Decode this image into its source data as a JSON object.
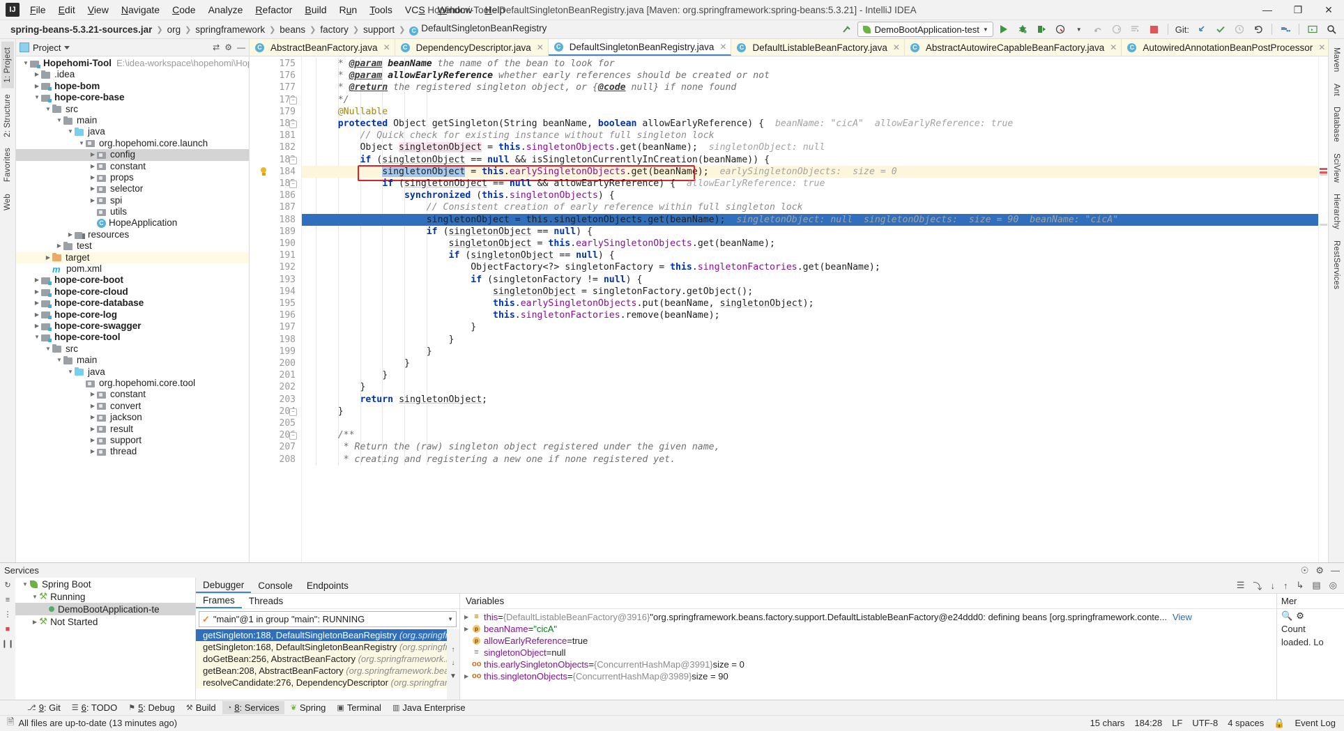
{
  "titlebar": {
    "logo": "IJ",
    "menus": [
      "File",
      "Edit",
      "View",
      "Navigate",
      "Code",
      "Analyze",
      "Refactor",
      "Build",
      "Run",
      "Tools",
      "VCS",
      "Window",
      "Help"
    ],
    "window_title": "Hopehomi-Tool - DefaultSingletonBeanRegistry.java [Maven: org.springframework:spring-beans:5.3.21] - IntelliJ IDEA",
    "minimize": "—",
    "maximize": "❐",
    "close": "✕"
  },
  "navbar": {
    "crumbs": [
      "spring-beans-5.3.21-sources.jar",
      "org",
      "springframework",
      "beans",
      "factory",
      "support",
      "DefaultSingletonBeanRegistry"
    ],
    "class_icon_letter": "C",
    "run_config": "DemoBootApplication-test",
    "git_label": "Git:"
  },
  "left_strip": {
    "tabs": [
      "1: Project",
      "2: Structure",
      "Favorites",
      "Web"
    ]
  },
  "right_strip": {
    "tabs": [
      "Maven",
      "Ant",
      "Database",
      "SciView",
      "Hierarchy",
      "RestServices"
    ]
  },
  "project": {
    "title": "Project",
    "tree": [
      {
        "depth": 0,
        "arrow": "down",
        "icon": "f-mod",
        "label": "Hopehomi-Tool",
        "bold": true,
        "path": "E:\\idea-workspace\\hopehomi\\Hopehomi-Too"
      },
      {
        "depth": 1,
        "arrow": "right",
        "icon": "f-gray",
        "label": ".idea",
        "bold": false
      },
      {
        "depth": 1,
        "arrow": "right",
        "icon": "f-mod",
        "label": "hope-bom",
        "bold": true
      },
      {
        "depth": 1,
        "arrow": "down",
        "icon": "f-mod",
        "label": "hope-core-base",
        "bold": true
      },
      {
        "depth": 2,
        "arrow": "down",
        "icon": "f-gray",
        "label": "src",
        "bold": false
      },
      {
        "depth": 3,
        "arrow": "down",
        "icon": "f-gray",
        "label": "main",
        "bold": false
      },
      {
        "depth": 4,
        "arrow": "down",
        "icon": "f-blue",
        "label": "java",
        "bold": false
      },
      {
        "depth": 5,
        "arrow": "down",
        "icon": "f-pkg",
        "label": "org.hopehomi.core.launch",
        "bold": false
      },
      {
        "depth": 6,
        "arrow": "right",
        "icon": "f-pkg",
        "label": "config",
        "bold": false,
        "state": "sel"
      },
      {
        "depth": 6,
        "arrow": "right",
        "icon": "f-pkg",
        "label": "constant",
        "bold": false
      },
      {
        "depth": 6,
        "arrow": "right",
        "icon": "f-pkg",
        "label": "props",
        "bold": false
      },
      {
        "depth": 6,
        "arrow": "right",
        "icon": "f-pkg",
        "label": "selector",
        "bold": false
      },
      {
        "depth": 6,
        "arrow": "right",
        "icon": "f-pkg",
        "label": "spi",
        "bold": false
      },
      {
        "depth": 6,
        "arrow": "none",
        "icon": "f-pkg",
        "label": "utils",
        "bold": false
      },
      {
        "depth": 6,
        "arrow": "none",
        "icon": "i-class",
        "label": "HopeApplication",
        "bold": false
      },
      {
        "depth": 4,
        "arrow": "right",
        "icon": "f-res",
        "label": "resources",
        "bold": false
      },
      {
        "depth": 3,
        "arrow": "right",
        "icon": "f-gray",
        "label": "test",
        "bold": false
      },
      {
        "depth": 2,
        "arrow": "right",
        "icon": "f-orange",
        "label": "target",
        "bold": false,
        "state": "hl"
      },
      {
        "depth": 2,
        "arrow": "none",
        "icon": "i-mvn",
        "label": "pom.xml",
        "bold": false
      },
      {
        "depth": 1,
        "arrow": "right",
        "icon": "f-mod",
        "label": "hope-core-boot",
        "bold": true
      },
      {
        "depth": 1,
        "arrow": "right",
        "icon": "f-mod",
        "label": "hope-core-cloud",
        "bold": true
      },
      {
        "depth": 1,
        "arrow": "right",
        "icon": "f-mod",
        "label": "hope-core-database",
        "bold": true
      },
      {
        "depth": 1,
        "arrow": "right",
        "icon": "f-mod",
        "label": "hope-core-log",
        "bold": true
      },
      {
        "depth": 1,
        "arrow": "right",
        "icon": "f-mod",
        "label": "hope-core-swagger",
        "bold": true
      },
      {
        "depth": 1,
        "arrow": "down",
        "icon": "f-mod",
        "label": "hope-core-tool",
        "bold": true
      },
      {
        "depth": 2,
        "arrow": "down",
        "icon": "f-gray",
        "label": "src",
        "bold": false
      },
      {
        "depth": 3,
        "arrow": "down",
        "icon": "f-gray",
        "label": "main",
        "bold": false
      },
      {
        "depth": 4,
        "arrow": "down",
        "icon": "f-blue",
        "label": "java",
        "bold": false
      },
      {
        "depth": 5,
        "arrow": "none",
        "icon": "f-pkg",
        "label": "org.hopehomi.core.tool",
        "bold": false
      },
      {
        "depth": 6,
        "arrow": "right",
        "icon": "f-pkg",
        "label": "constant",
        "bold": false
      },
      {
        "depth": 6,
        "arrow": "right",
        "icon": "f-pkg",
        "label": "convert",
        "bold": false
      },
      {
        "depth": 6,
        "arrow": "right",
        "icon": "f-pkg",
        "label": "jackson",
        "bold": false
      },
      {
        "depth": 6,
        "arrow": "right",
        "icon": "f-pkg",
        "label": "result",
        "bold": false
      },
      {
        "depth": 6,
        "arrow": "right",
        "icon": "f-pkg",
        "label": "support",
        "bold": false
      },
      {
        "depth": 6,
        "arrow": "right",
        "icon": "f-pkg",
        "label": "thread",
        "bold": false
      }
    ]
  },
  "editor": {
    "tabs": [
      {
        "label": "AbstractBeanFactory.java",
        "active": false
      },
      {
        "label": "DependencyDescriptor.java",
        "active": false
      },
      {
        "label": "DefaultSingletonBeanRegistry.java",
        "active": true
      },
      {
        "label": "DefaultListableBeanFactory.java",
        "active": false
      },
      {
        "label": "AbstractAutowireCapableBeanFactory.java",
        "active": false
      },
      {
        "label": "AutowiredAnnotationBeanPostProcessor",
        "active": false
      }
    ],
    "first_line": 175,
    "lines": [
      {
        "n": 175,
        "html": "     <span class='jd'>* </span><span class='jdt'>@param</span><span class='jdb'> beanName </span><span class='jd'>the name of the bean to look for</span>"
      },
      {
        "n": 176,
        "html": "     <span class='jd'>* </span><span class='jdt'>@param</span><span class='jdb'> allowEarlyReference </span><span class='jd'>whether early references should be created or not</span>"
      },
      {
        "n": 177,
        "html": "     <span class='jd'>* </span><span class='jdt'>@return</span><span class='jd'> the registered singleton object, or {</span><span class='jdt'>@code</span><span class='jd'> null} if none found</span>"
      },
      {
        "n": 178,
        "html": "     <span class='jd'>*/</span>",
        "fold": true
      },
      {
        "n": 179,
        "html": "     <span class='ann'>@Nullable</span>"
      },
      {
        "n": 180,
        "html": "     <span class='k'>protected</span> Object getSingleton(String beanName, <span class='k'>boolean</span> allowEarlyReference) {  <span class='hint'>beanName: \"cicA\"  allowEarlyReference: true</span>",
        "fold": true
      },
      {
        "n": 181,
        "html": "         <span class='com'>// Quick check for existing instance without full singleton lock</span>"
      },
      {
        "n": 182,
        "html": "         Object <span class='pinkbg usg'>singletonObject</span> = <span class='k'>this</span>.<span class='fld'>singletonObjects</span>.get(beanName);  <span class='hint'>singletonObject: null</span>"
      },
      {
        "n": 183,
        "html": "         <span class='k'>if</span> (<span class='usg errund'>singletonObject</span> == <span class='k'>null</span> &amp;&amp; isSingletonCurrentlyInCreation(beanName)) {",
        "fold": true
      },
      {
        "n": 184,
        "html": "             <span class='bluesel'>singletonObject</span> = <span class='k'>this</span>.<span class='fld'>earlySingletonObjects</span>.get(beanName);  <span class='hint'>earlySingletonObjects:  size = 0</span>",
        "caret": true,
        "bulb": true,
        "redbox": true
      },
      {
        "n": 185,
        "html": "             <span class='k'>if</span> (<span class='usg'>singletonObject</span> == <span class='k'>null</span> &amp;&amp; allowEarlyReference) {  <span class='hint'>allowEarlyReference: true</span>",
        "fold": true
      },
      {
        "n": 186,
        "html": "                 <span class='k'>synchronized</span> (<span class='k'>this</span>.<span class='fld'>singletonObjects</span>) {"
      },
      {
        "n": 187,
        "html": "                     <span class='com'>// Consistent creation of early reference within full singleton lock</span>"
      },
      {
        "n": 188,
        "html": "                     singletonObject = this.singletonObjects.get(beanName);  <span class='hint'>singletonObject: null  singletonObjects:  size = 90  beanName: \"cicA\"</span>",
        "selected": true
      },
      {
        "n": 189,
        "html": "                     <span class='k'>if</span> (<span class='usg'>singletonObject</span> == <span class='k'>null</span>) {"
      },
      {
        "n": 190,
        "html": "                         <span class='usg'>singletonObject</span> = <span class='k'>this</span>.<span class='fld'>earlySingletonObjects</span>.get(beanName);"
      },
      {
        "n": 191,
        "html": "                         <span class='k'>if</span> (<span class='usg'>singletonObject</span> == <span class='k'>null</span>) {"
      },
      {
        "n": 192,
        "html": "                             ObjectFactory&lt;?&gt; singletonFactory = <span class='k'>this</span>.<span class='fld'>singletonFactories</span>.get(beanName);"
      },
      {
        "n": 193,
        "html": "                             <span class='k'>if</span> (singletonFactory != <span class='k'>null</span>) {"
      },
      {
        "n": 194,
        "html": "                                 <span class='usg'>singletonObject</span> = singletonFactory.getObject();"
      },
      {
        "n": 195,
        "html": "                                 <span class='k'>this</span>.<span class='fld'>earlySingletonObjects</span>.put(beanName, <span class='usg'>singletonObject</span>);"
      },
      {
        "n": 196,
        "html": "                                 <span class='k'>this</span>.<span class='fld'>singletonFactories</span>.remove(beanName);"
      },
      {
        "n": 197,
        "html": "                             }"
      },
      {
        "n": 198,
        "html": "                         }"
      },
      {
        "n": 199,
        "html": "                     }"
      },
      {
        "n": 200,
        "html": "                 }"
      },
      {
        "n": 201,
        "html": "             }"
      },
      {
        "n": 202,
        "html": "         }"
      },
      {
        "n": 203,
        "html": "         <span class='k'>return</span> <span class='usg'>singletonObject</span>;"
      },
      {
        "n": 204,
        "html": "     }",
        "fold": true
      },
      {
        "n": 205,
        "html": ""
      },
      {
        "n": 206,
        "html": "     <span class='jd'>/**</span>",
        "fold": true
      },
      {
        "n": 207,
        "html": "      <span class='jd'>* Return the (raw) singleton object registered under the given name,</span>"
      },
      {
        "n": 208,
        "html": "      <span class='jd'>* creating and registering a new one if none registered yet.</span>"
      }
    ]
  },
  "services": {
    "title": "Services",
    "tree": [
      {
        "label": "Spring Boot",
        "kind": "root",
        "arrow": "down"
      },
      {
        "label": "Running",
        "kind": "group",
        "arrow": "down"
      },
      {
        "label": "DemoBootApplication-te",
        "kind": "item",
        "arrow": "none",
        "selected": true
      },
      {
        "label": "Not Started",
        "kind": "group",
        "arrow": "right"
      }
    ],
    "debug_tabs": [
      {
        "label": "Debugger",
        "active": true,
        "icon": ""
      },
      {
        "label": "Console",
        "active": false,
        "icon": "console-icon"
      },
      {
        "label": "Endpoints",
        "active": false,
        "icon": "endpoints-icon"
      }
    ],
    "frames": {
      "tabs": [
        "Frames",
        "Threads"
      ],
      "active_tab": "Frames",
      "thread_selector": "\"main\"@1 in group \"main\": RUNNING",
      "items": [
        {
          "method": "getSingleton:188, DefaultSingletonBeanRegistry ",
          "pkg": "(org.springframework.beans",
          "selected": true
        },
        {
          "method": "getSingleton:168, DefaultSingletonBeanRegistry ",
          "pkg": "(org.springframework.beans",
          "selected": false
        },
        {
          "method": "doGetBean:256, AbstractBeanFactory ",
          "pkg": "(org.springframework.beans.factory.su",
          "selected": false
        },
        {
          "method": "getBean:208, AbstractBeanFactory ",
          "pkg": "(org.springframework.beans.factory.supp",
          "selected": false
        },
        {
          "method": "resolveCandidate:276, DependencyDescriptor ",
          "pkg": "(org.springframework.beans.fa",
          "selected": false
        }
      ]
    },
    "variables": {
      "title": "Variables",
      "rows": [
        {
          "arrow": "right",
          "icon": "eq",
          "name": "this",
          "op": " = ",
          "gray": "{DefaultListableBeanFactory@3916} ",
          "value": "\"org.springframework.beans.factory.support.DefaultListableBeanFactory@e24ddd0: defining beans [org.springframework.conte...",
          "link": "View"
        },
        {
          "arrow": "right",
          "icon": "p",
          "name": "beanName",
          "op": " = ",
          "gray": "",
          "value": "\"cicA\"",
          "valclass": "vstr"
        },
        {
          "arrow": "none",
          "icon": "p",
          "name": "allowEarlyReference",
          "op": " = ",
          "gray": "",
          "value": "true"
        },
        {
          "arrow": "none",
          "icon": "eq",
          "name": "singletonObject",
          "op": " = ",
          "gray": "",
          "value": "null"
        },
        {
          "arrow": "none",
          "icon": "oo",
          "name": "this.earlySingletonObjects",
          "op": " = ",
          "gray": "{ConcurrentHashMap@3991}  ",
          "value": "size = 0"
        },
        {
          "arrow": "right",
          "icon": "oo",
          "name": "this.singletonObjects",
          "op": " = ",
          "gray": "{ConcurrentHashMap@3989}  ",
          "value": "size = 90"
        }
      ]
    },
    "memory": {
      "title": "Mer",
      "rows": [
        "Count",
        "loaded. Lo"
      ]
    }
  },
  "bottom_tabs": [
    {
      "label": "9: Git",
      "icon": "git-icon",
      "sel": false
    },
    {
      "label": "6: TODO",
      "icon": "todo-icon",
      "sel": false
    },
    {
      "label": "5: Debug",
      "icon": "debug-icon",
      "sel": false
    },
    {
      "label": "Build",
      "icon": "build-icon",
      "sel": false
    },
    {
      "label": "8: Services",
      "icon": "services-icon",
      "sel": true
    },
    {
      "label": "Spring",
      "icon": "spring-icon",
      "sel": false
    },
    {
      "label": "Terminal",
      "icon": "terminal-icon",
      "sel": false
    },
    {
      "label": "Java Enterprise",
      "icon": "java-ee-icon",
      "sel": false
    }
  ],
  "statusbar": {
    "message": "All files are up-to-date (13 minutes ago)",
    "chars": "15 chars",
    "caret": "184:28",
    "line_sep": "LF",
    "encoding": "UTF-8",
    "indent": "4 spaces",
    "event_log": "Event Log"
  }
}
